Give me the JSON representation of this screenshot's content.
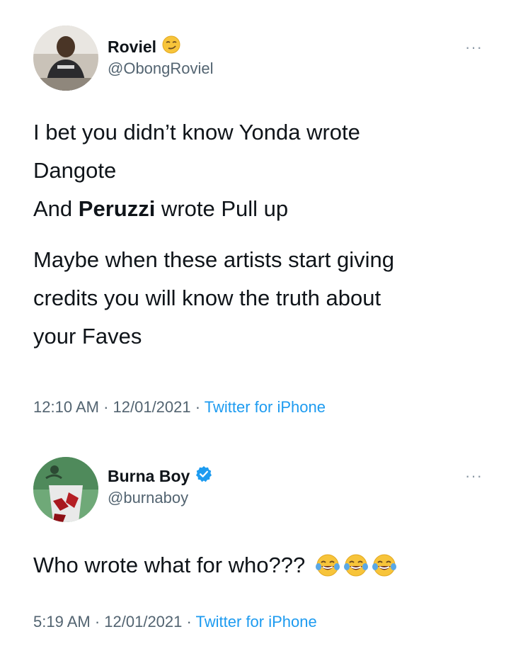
{
  "tweets": [
    {
      "author_name": "Roviel",
      "author_name_emoji": "smirking-face-emoji",
      "handle": "@ObongRoviel",
      "more_label": "···",
      "text_line1": "I bet you didn’t know Yonda wrote",
      "text_line2": "Dangote",
      "text_line3_prefix": "And ",
      "text_line3_bold": "Peruzzi",
      "text_line3_suffix": " wrote Pull up",
      "text_para2_line1": "Maybe when these artists start giving",
      "text_para2_line2": "credits you will know the truth about",
      "text_para2_line3": "your Faves",
      "time": "12:10 AM",
      "separator": " · ",
      "date": "12/01/2021",
      "source": "Twitter for iPhone"
    },
    {
      "author_name": "Burna Boy",
      "verified": true,
      "handle": "@burnaboy",
      "more_label": "···",
      "text": "Who wrote what for who???",
      "emojis": [
        "face-with-tears-of-joy-emoji",
        "face-with-tears-of-joy-emoji",
        "face-with-tears-of-joy-emoji"
      ],
      "time": "5:19 AM",
      "separator": " · ",
      "date": "12/01/2021",
      "source": "Twitter for iPhone"
    }
  ],
  "colors": {
    "text": "#0f1419",
    "secondary": "#536471",
    "link": "#1d9bf0",
    "verified": "#1d9bf0"
  }
}
